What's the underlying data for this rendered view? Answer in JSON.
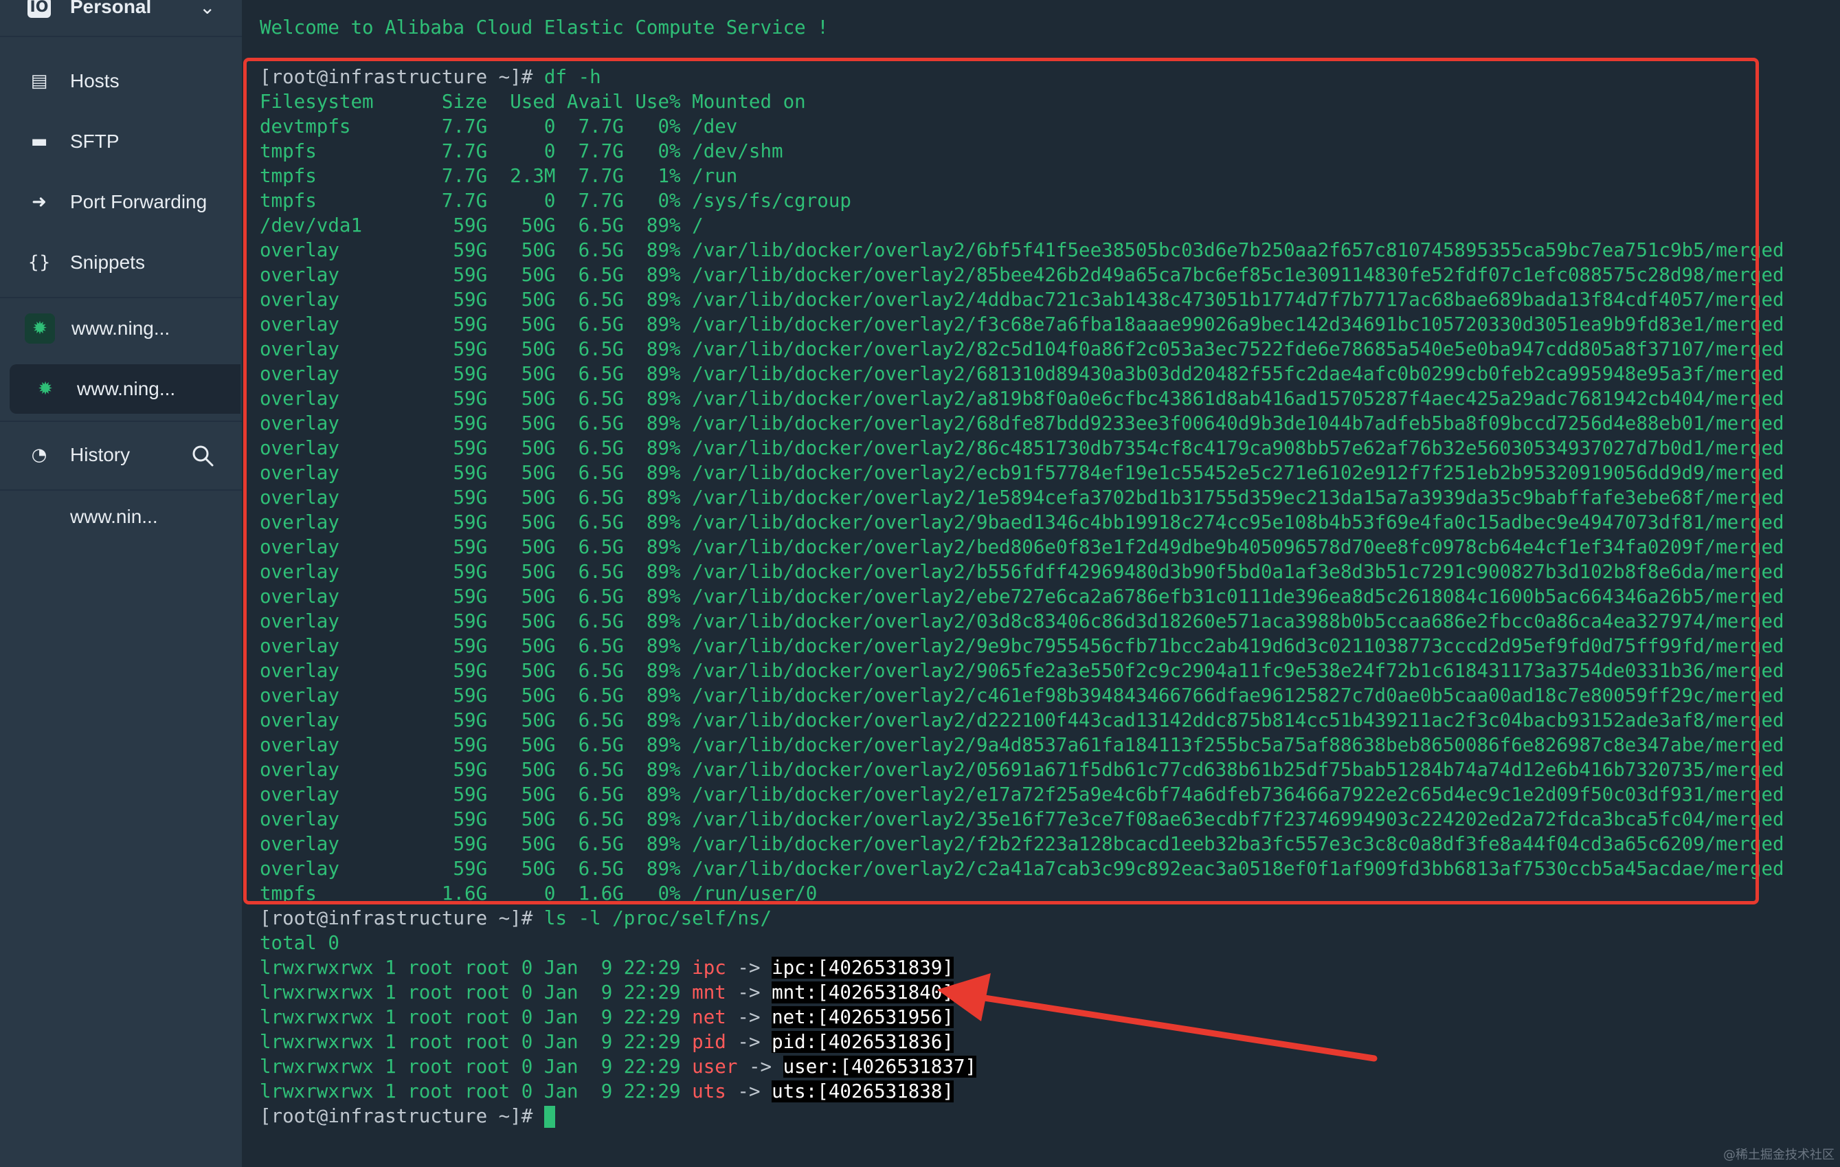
{
  "sidebar": {
    "workspace": "Personal",
    "items": [
      {
        "label": "Hosts",
        "icon": "hosts-icon"
      },
      {
        "label": "SFTP",
        "icon": "folder-icon"
      },
      {
        "label": "Port Forwarding",
        "icon": "port-forward-icon"
      },
      {
        "label": "Snippets",
        "icon": "braces-icon"
      }
    ],
    "hosts": [
      {
        "label": "www.ning...",
        "active": false
      },
      {
        "label": "www.ning...",
        "active": true
      }
    ],
    "history": {
      "label": "History",
      "entries": [
        "www.nin..."
      ]
    }
  },
  "terminal": {
    "welcome": "Welcome to Alibaba Cloud Elastic Compute Service !",
    "prompt": "[root@infrastructure ~]#",
    "cmd_df": " df -h",
    "df_header": "Filesystem      Size  Used Avail Use% Mounted on",
    "df_rows": [
      "devtmpfs        7.7G     0  7.7G   0% /dev",
      "tmpfs           7.7G     0  7.7G   0% /dev/shm",
      "tmpfs           7.7G  2.3M  7.7G   1% /run",
      "tmpfs           7.7G     0  7.7G   0% /sys/fs/cgroup",
      "/dev/vda1        59G   50G  6.5G  89% /",
      "overlay          59G   50G  6.5G  89% /var/lib/docker/overlay2/6bf5f41f5ee38505bc03d6e7b250aa2f657c810745895355ca59bc7ea751c9b5/merged",
      "overlay          59G   50G  6.5G  89% /var/lib/docker/overlay2/85bee426b2d49a65ca7bc6ef85c1e309114830fe52fdf07c1efc088575c28d98/merged",
      "overlay          59G   50G  6.5G  89% /var/lib/docker/overlay2/4ddbac721c3ab1438c473051b1774d7f7b7717ac68bae689bada13f84cdf4057/merged",
      "overlay          59G   50G  6.5G  89% /var/lib/docker/overlay2/f3c68e7a6fba18aaae99026a9bec142d34691bc105720330d3051ea9b9fd83e1/merged",
      "overlay          59G   50G  6.5G  89% /var/lib/docker/overlay2/82c5d104f0a86f2c053a3ec7522fde6e78685a540e5e0ba947cdd805a8f37107/merged",
      "overlay          59G   50G  6.5G  89% /var/lib/docker/overlay2/681310d89430a3b03dd20482f55fc2dae4afc0b0299cb0feb2ca995948e95a3f/merged",
      "overlay          59G   50G  6.5G  89% /var/lib/docker/overlay2/a819b8f0a0e6cfbc43861d8ab416ad15705287f4aec425a29adc7681942cb404/merged",
      "overlay          59G   50G  6.5G  89% /var/lib/docker/overlay2/68dfe87bdd9233ee3f00640d9b3de1044b7adfeb5ba8f09bccd7256d4e88eb01/merged",
      "overlay          59G   50G  6.5G  89% /var/lib/docker/overlay2/86c4851730db7354cf8c4179ca908bb57e62af76b32e56030534937027d7b0d1/merged",
      "overlay          59G   50G  6.5G  89% /var/lib/docker/overlay2/ecb91f57784ef19e1c55452e5c271e6102e912f7f251eb2b95320919056dd9d9/merged",
      "overlay          59G   50G  6.5G  89% /var/lib/docker/overlay2/1e5894cefa3702bd1b31755d359ec213da15a7a3939da35c9babffafe3ebe68f/merged",
      "overlay          59G   50G  6.5G  89% /var/lib/docker/overlay2/9baed1346c4bb19918c274cc95e108b4b53f69e4fa0c15adbec9e4947073df81/merged",
      "overlay          59G   50G  6.5G  89% /var/lib/docker/overlay2/bed806e0f83e1f2d49dbe9b405096578d70ee8fc0978cb64e4cf1ef34fa0209f/merged",
      "overlay          59G   50G  6.5G  89% /var/lib/docker/overlay2/b556fdff42969480d3b90f5bd0a1af3e8d3b51c7291c900827b3d102b8f8e6da/merged",
      "overlay          59G   50G  6.5G  89% /var/lib/docker/overlay2/ebe727e6ca2a6786efb31c0111de396ea8d5c2618084c1600b5ac664346a26b5/merged",
      "overlay          59G   50G  6.5G  89% /var/lib/docker/overlay2/03d8c83406c86d3d18260e571aca3988b0b5ccaa686e2fbcc0a86ca4ea327974/merged",
      "overlay          59G   50G  6.5G  89% /var/lib/docker/overlay2/9e9bc7955456cfb71bcc2ab419d6d3c0211038773cccd2d95ef9fd0d75ff99fd/merged",
      "overlay          59G   50G  6.5G  89% /var/lib/docker/overlay2/9065fe2a3e550f2c9c2904a11fc9e538e24f72b1c618431173a3754de0331b36/merged",
      "overlay          59G   50G  6.5G  89% /var/lib/docker/overlay2/c461ef98b394843466766dfae96125827c7d0ae0b5caa00ad18c7e80059ff29c/merged",
      "overlay          59G   50G  6.5G  89% /var/lib/docker/overlay2/d222100f443cad13142ddc875b814cc51b439211ac2f3c04bacb93152ade3af8/merged",
      "overlay          59G   50G  6.5G  89% /var/lib/docker/overlay2/9a4d8537a61fa184113f255bc5a75af88638beb8650086f6e826987c8e347abe/merged",
      "overlay          59G   50G  6.5G  89% /var/lib/docker/overlay2/05691a671f5db61c77cd638b61b25df75bab51284b74a74d12e6b416b7320735/merged",
      "overlay          59G   50G  6.5G  89% /var/lib/docker/overlay2/e17a72f25a9e4c6bf74a6dfeb736466a7922e2c65d4ec9c1e2d09f50c03df931/merged",
      "overlay          59G   50G  6.5G  89% /var/lib/docker/overlay2/35e16f77e3ce7f08ae63ecdbf7f23746994903c224202ed2a72fdca3bca5fc04/merged",
      "overlay          59G   50G  6.5G  89% /var/lib/docker/overlay2/f2b2f223a128bcacd1eeb32ba3fc557e3c3c8c0a8df3fe8a44f04cd3a65c6209/merged",
      "overlay          59G   50G  6.5G  89% /var/lib/docker/overlay2/c2a41a7cab3c99c892eac3a0518ef0f1af909fd3bb6813af7530ccb5a45acdae/merged",
      "tmpfs           1.6G     0  1.6G   0% /run/user/0"
    ],
    "cmd_ls": " ls -l /proc/self/ns/",
    "total": "total 0",
    "ns_rows": [
      {
        "perm": "lrwxrwxrwx 1 root root 0 Jan  9 22:29 ",
        "name": "ipc",
        "arrow": " -> ",
        "target": "ipc:[4026531839]"
      },
      {
        "perm": "lrwxrwxrwx 1 root root 0 Jan  9 22:29 ",
        "name": "mnt",
        "arrow": " -> ",
        "target": "mnt:[4026531840]"
      },
      {
        "perm": "lrwxrwxrwx 1 root root 0 Jan  9 22:29 ",
        "name": "net",
        "arrow": " -> ",
        "target": "net:[4026531956]"
      },
      {
        "perm": "lrwxrwxrwx 1 root root 0 Jan  9 22:29 ",
        "name": "pid",
        "arrow": " -> ",
        "target": "pid:[4026531836]"
      },
      {
        "perm": "lrwxrwxrwx 1 root root 0 Jan  9 22:29 ",
        "name": "user",
        "arrow": " -> ",
        "target": "user:[4026531837]"
      },
      {
        "perm": "lrwxrwxrwx 1 root root 0 Jan  9 22:29 ",
        "name": "uts",
        "arrow": " -> ",
        "target": "uts:[4026531838]"
      }
    ]
  },
  "watermark": "@稀土掘金技术社区",
  "colors": {
    "terminal_green": "#2fbf77",
    "annotation_red": "#e83a2f",
    "symlink_red": "#ff5a5a",
    "sidebar_bg": "#2a3947",
    "terminal_bg": "#1e2a35"
  }
}
